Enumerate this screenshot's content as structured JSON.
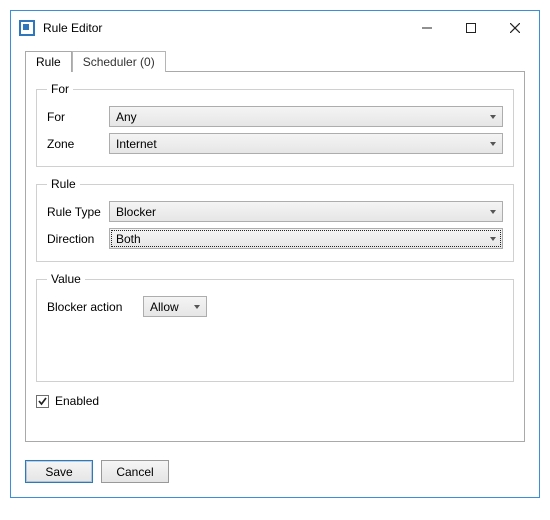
{
  "window": {
    "title": "Rule Editor"
  },
  "tabs": {
    "rule": "Rule",
    "scheduler": "Scheduler (0)"
  },
  "for_group": {
    "legend": "For",
    "for_label": "For",
    "for_value": "Any",
    "zone_label": "Zone",
    "zone_value": "Internet"
  },
  "rule_group": {
    "legend": "Rule",
    "type_label": "Rule Type",
    "type_value": "Blocker",
    "direction_label": "Direction",
    "direction_value": "Both"
  },
  "value_group": {
    "legend": "Value",
    "blocker_action_label": "Blocker action",
    "blocker_action_value": "Allow"
  },
  "enabled": {
    "label": "Enabled",
    "checked": true
  },
  "buttons": {
    "save": "Save",
    "cancel": "Cancel"
  }
}
